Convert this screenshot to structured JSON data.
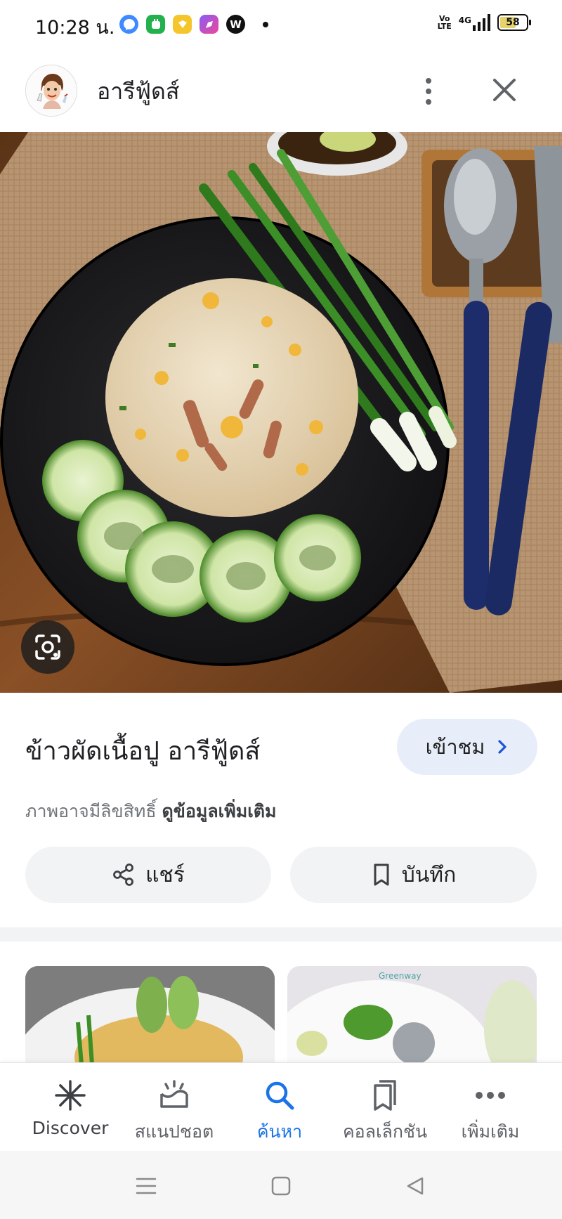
{
  "status_bar": {
    "time": "10:28 น.",
    "volte": "Vo LTE",
    "network": "4G",
    "battery": "58",
    "app_icons": [
      "messenger-icon",
      "line-icon",
      "yellow-app-icon",
      "pink-app-icon",
      "w-app-icon"
    ],
    "w_app_letter": "W"
  },
  "header": {
    "site_name": "อารีฟู้ดส์"
  },
  "result": {
    "title": "ข้าวผัดเนื้อปู อารีฟู้ดส์",
    "visit_label": "เข้าชม",
    "copyright_text": "ภาพอาจมีลิขสิทธิ์",
    "learn_more": "ดูข้อมูลเพิ่มเติม",
    "share_label": "แชร์",
    "save_label": "บันทึก"
  },
  "bottom_nav": {
    "items": [
      {
        "label": "Discover",
        "icon": "asterisk-icon"
      },
      {
        "label": "สแนปชอต",
        "icon": "snapshot-icon"
      },
      {
        "label": "ค้นหา",
        "icon": "search-icon",
        "active": true
      },
      {
        "label": "คอลเล็กชัน",
        "icon": "collections-icon"
      },
      {
        "label": "เพิ่มเติม",
        "icon": "more-horizontal-icon"
      }
    ]
  },
  "colors": {
    "accent": "#1a73e8",
    "visit_button_bg": "#e8eef9",
    "chip_bg": "#f1f3f4"
  }
}
